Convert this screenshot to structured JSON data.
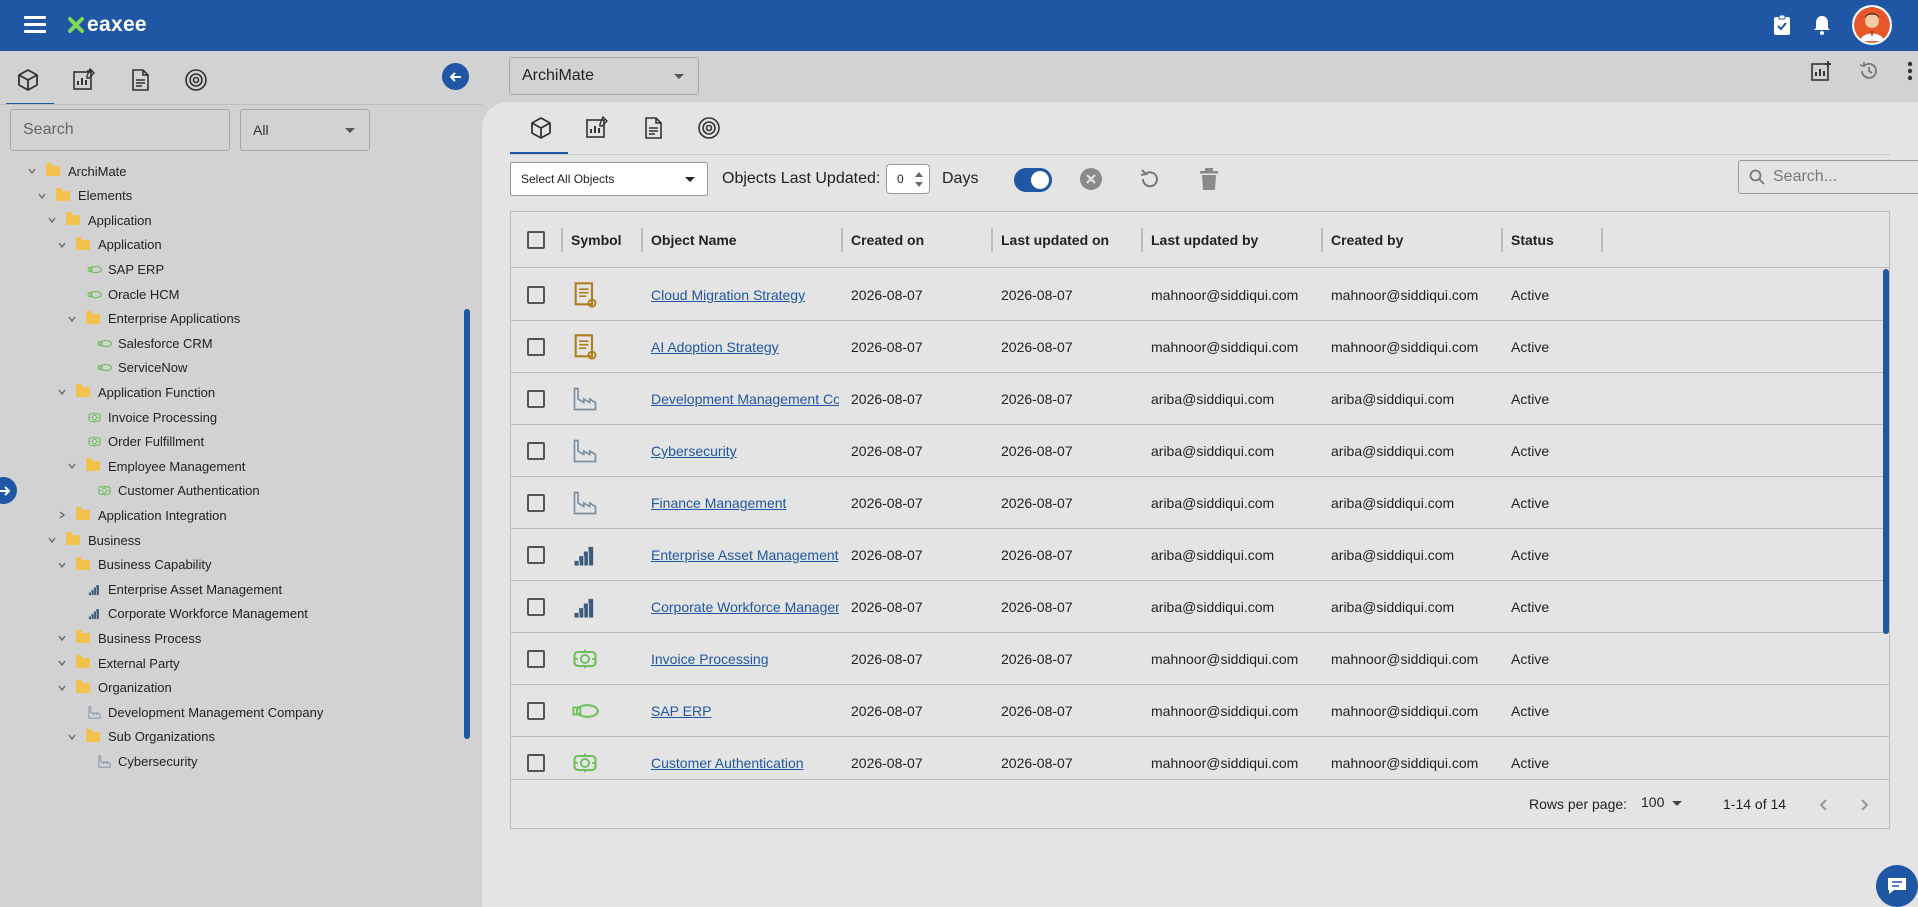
{
  "header": {
    "brand": "eaxee",
    "colors": {
      "primary": "#1f57a4",
      "folder": "#f2c14e",
      "link": "#1f57a4"
    },
    "icons": [
      "menu-icon",
      "task-checklist-icon",
      "bell-icon",
      "user-avatar"
    ]
  },
  "left_panel": {
    "tabs": [
      "cube-icon",
      "chart-edit-icon",
      "document-icon",
      "target-icon"
    ],
    "search": {
      "placeholder": "Search",
      "value": ""
    },
    "filter": {
      "selected": "All"
    },
    "tree": [
      {
        "label": "ArchiMate",
        "type": "folder",
        "level": 0,
        "expanded": true
      },
      {
        "label": "Elements",
        "type": "folder",
        "level": 1,
        "expanded": true
      },
      {
        "label": "Application",
        "type": "folder",
        "level": 2,
        "expanded": true
      },
      {
        "label": "Application",
        "type": "folder",
        "level": 3,
        "expanded": true
      },
      {
        "label": "SAP ERP",
        "type": "application-component",
        "level": 4
      },
      {
        "label": "Oracle HCM",
        "type": "application-component",
        "level": 4
      },
      {
        "label": "Enterprise Applications",
        "type": "folder",
        "level": 4,
        "expanded": true
      },
      {
        "label": "Salesforce CRM",
        "type": "application-component",
        "level": 5
      },
      {
        "label": "ServiceNow",
        "type": "application-component",
        "level": 5
      },
      {
        "label": "Application Function",
        "type": "folder",
        "level": 3,
        "expanded": true
      },
      {
        "label": "Invoice Processing",
        "type": "application-function",
        "level": 4
      },
      {
        "label": "Order Fulfillment",
        "type": "application-function",
        "level": 4
      },
      {
        "label": "Employee Management",
        "type": "folder",
        "level": 4,
        "expanded": true
      },
      {
        "label": "Customer Authentication",
        "type": "application-function",
        "level": 5
      },
      {
        "label": "Application Integration",
        "type": "folder",
        "level": 3,
        "expanded": false
      },
      {
        "label": "Business",
        "type": "folder",
        "level": 2,
        "expanded": true
      },
      {
        "label": "Business Capability",
        "type": "folder",
        "level": 3,
        "expanded": true
      },
      {
        "label": "Enterprise Asset Management",
        "type": "capability",
        "level": 4
      },
      {
        "label": "Corporate Workforce Management",
        "type": "capability",
        "level": 4
      },
      {
        "label": "Business Process",
        "type": "folder",
        "level": 3,
        "expanded": true
      },
      {
        "label": "External Party",
        "type": "folder",
        "level": 3,
        "expanded": true
      },
      {
        "label": "Organization",
        "type": "folder",
        "level": 3,
        "expanded": true
      },
      {
        "label": "Development Management Company",
        "type": "organization",
        "level": 4
      },
      {
        "label": "Sub Organizations",
        "type": "folder",
        "level": 4,
        "expanded": true
      },
      {
        "label": "Cybersecurity",
        "type": "organization",
        "level": 5
      }
    ]
  },
  "main": {
    "framework_select": "ArchiMate",
    "top_right_icons": [
      "add-chart-icon",
      "history-icon",
      "more-vert-icon"
    ],
    "tabs": [
      "cube-icon",
      "chart-edit-icon",
      "document-icon",
      "target-icon"
    ],
    "toolbar": {
      "select_all": "Select All Objects",
      "last_updated_label": "Objects Last Updated:",
      "days_value": "0",
      "days_label": "Days",
      "toggle_on": true,
      "search_placeholder": "Search..."
    },
    "table": {
      "columns": [
        "Symbol",
        "Object Name",
        "Created on",
        "Last updated on",
        "Last updated by",
        "Created by",
        "Status"
      ],
      "rows": [
        {
          "symbol": "strategy",
          "name": "Cloud Migration Strategy",
          "created_on": "2026-08-07",
          "updated_on": "2026-08-07",
          "updated_by": "mahnoor@siddiqui.com",
          "created_by": "mahnoor@siddiqui.com",
          "status": "Active"
        },
        {
          "symbol": "strategy",
          "name": "AI Adoption Strategy",
          "created_on": "2026-08-07",
          "updated_on": "2026-08-07",
          "updated_by": "mahnoor@siddiqui.com",
          "created_by": "mahnoor@siddiqui.com",
          "status": "Active"
        },
        {
          "symbol": "organization",
          "name": "Development Management Co",
          "created_on": "2026-08-07",
          "updated_on": "2026-08-07",
          "updated_by": "ariba@siddiqui.com",
          "created_by": "ariba@siddiqui.com",
          "status": "Active"
        },
        {
          "symbol": "organization",
          "name": "Cybersecurity",
          "created_on": "2026-08-07",
          "updated_on": "2026-08-07",
          "updated_by": "ariba@siddiqui.com",
          "created_by": "ariba@siddiqui.com",
          "status": "Active"
        },
        {
          "symbol": "organization",
          "name": "Finance Management",
          "created_on": "2026-08-07",
          "updated_on": "2026-08-07",
          "updated_by": "ariba@siddiqui.com",
          "created_by": "ariba@siddiqui.com",
          "status": "Active"
        },
        {
          "symbol": "capability",
          "name": "Enterprise Asset Management",
          "created_on": "2026-08-07",
          "updated_on": "2026-08-07",
          "updated_by": "ariba@siddiqui.com",
          "created_by": "ariba@siddiqui.com",
          "status": "Active"
        },
        {
          "symbol": "capability",
          "name": "Corporate Workforce Managen",
          "created_on": "2026-08-07",
          "updated_on": "2026-08-07",
          "updated_by": "ariba@siddiqui.com",
          "created_by": "ariba@siddiqui.com",
          "status": "Active"
        },
        {
          "symbol": "application-function",
          "name": "Invoice Processing",
          "created_on": "2026-08-07",
          "updated_on": "2026-08-07",
          "updated_by": "mahnoor@siddiqui.com",
          "created_by": "mahnoor@siddiqui.com",
          "status": "Active"
        },
        {
          "symbol": "application-component",
          "name": "SAP ERP",
          "created_on": "2026-08-07",
          "updated_on": "2026-08-07",
          "updated_by": "mahnoor@siddiqui.com",
          "created_by": "mahnoor@siddiqui.com",
          "status": "Active"
        },
        {
          "symbol": "application-function",
          "name": "Customer Authentication",
          "created_on": "2026-08-07",
          "updated_on": "2026-08-07",
          "updated_by": "mahnoor@siddiqui.com",
          "created_by": "mahnoor@siddiqui.com",
          "status": "Active"
        }
      ]
    },
    "pagination": {
      "rows_per_page_label": "Rows per page:",
      "rows_per_page": "100",
      "range": "1-14 of 14"
    }
  }
}
